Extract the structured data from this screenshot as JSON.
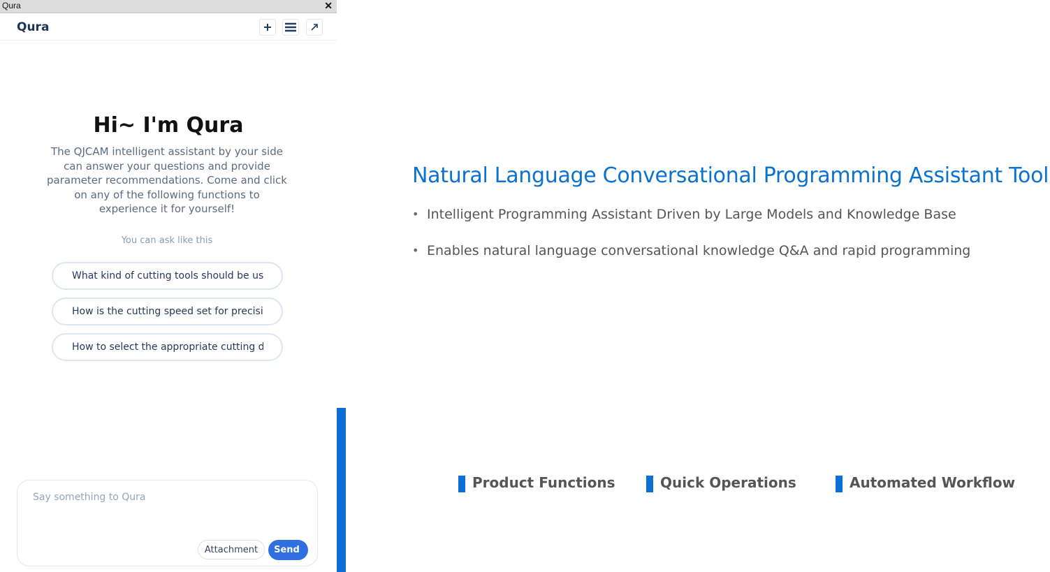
{
  "window": {
    "title": "Qura",
    "close_glyph": "✕"
  },
  "header": {
    "brand": "Qura",
    "buttons": [
      {
        "name": "new-chat",
        "icon": "plus-icon"
      },
      {
        "name": "menu",
        "icon": "menu-icon"
      },
      {
        "name": "expand",
        "icon": "expand-arrow-icon"
      }
    ]
  },
  "welcome": {
    "greeting": "Hi~ I'm Qura",
    "intro": "The QJCAM intelligent assistant by your side can answer your questions and provide parameter recommendations. Come and click on any of the following functions to experience it for yourself!",
    "ask_hint": "You can ask like this",
    "suggestions": [
      "What kind of cutting tools should be used",
      "How is the cutting speed set for precision",
      "How to select the appropriate cutting depth"
    ]
  },
  "composer": {
    "placeholder": "Say something to Qura",
    "attachment_label": "Attachment",
    "send_label": "Send"
  },
  "slide": {
    "title": "Natural Language Conversational Programming Assistant Tool",
    "bullets": [
      "Intelligent Programming Assistant Driven by Large Models and Knowledge Base",
      "Enables natural language conversational knowledge Q&A and rapid programming"
    ],
    "features": [
      "Product Functions",
      "Quick Operations",
      "Automated Workflow"
    ]
  },
  "colors": {
    "accent": "#0a6fd6",
    "send_button": "#2f6fe0",
    "title_blue": "#0b72d0"
  }
}
